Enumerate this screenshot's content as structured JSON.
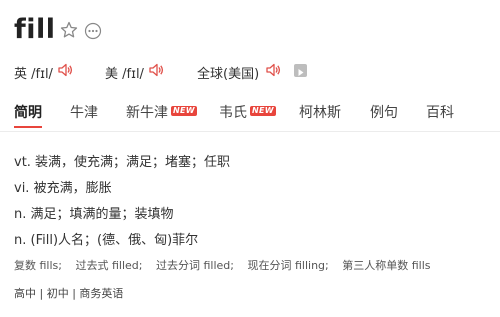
{
  "word": "fill",
  "pronunciations": [
    {
      "region": "英",
      "ipa": "/fɪl/"
    },
    {
      "region": "美",
      "ipa": "/fɪl/"
    },
    {
      "region": "全球(美国)",
      "ipa": ""
    }
  ],
  "tabs": [
    {
      "label": "简明",
      "active": true
    },
    {
      "label": "牛津"
    },
    {
      "label": "新牛津",
      "badge": "NEW"
    },
    {
      "label": "韦氏",
      "badge": "NEW"
    },
    {
      "label": "柯林斯"
    },
    {
      "label": "例句"
    },
    {
      "label": "百科"
    }
  ],
  "definitions": [
    "vt. 装满，使充满；满足；堵塞；任职",
    "vi. 被充满，膨胀",
    "n. 满足；填满的量；装填物",
    "n. (Fill)人名；(德、俄、匈)菲尔"
  ],
  "word_forms": [
    "复数 fills;",
    "过去式 filled;",
    "过去分词 filled;",
    "现在分词 filling;",
    "第三人称单数 fills"
  ],
  "levels": "高中 | 初中 | 商务英语",
  "colors": {
    "accent": "#e8453c",
    "speaker": "#e0504a"
  }
}
